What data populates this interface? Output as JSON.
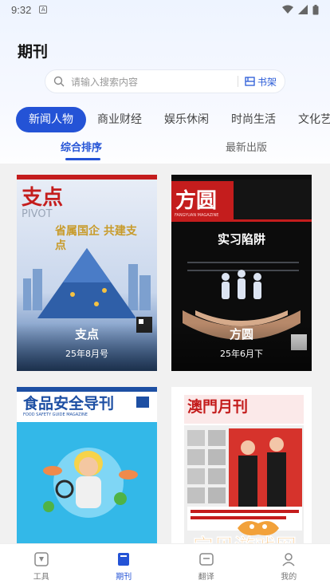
{
  "status": {
    "time": "9:32",
    "notif_badge": "A"
  },
  "page_title": "期刊",
  "search": {
    "placeholder": "请输入搜索内容",
    "shelf_label": "书架"
  },
  "categories": [
    "新闻人物",
    "商业财经",
    "娱乐休闲",
    "时尚生活",
    "文化艺"
  ],
  "active_category": "新闻人物",
  "sort_tabs": [
    "综合排序",
    "最新出版"
  ],
  "magazines": [
    {
      "title": "支点",
      "issue": "25年8月号",
      "cover_masthead": "支点",
      "cover_sub": "PIVOT",
      "cover_headline": "省属国企 共建支点"
    },
    {
      "title": "方圆",
      "issue": "25年6月下",
      "cover_masthead": "方圆",
      "cover_sub": "FANGYUAN MAGAZINE",
      "cover_headline": "实习陷阱"
    },
    {
      "title": "食品安全导刊",
      "issue": "",
      "cover_masthead": "食品安全导刊",
      "cover_sub": "FOOD SAFETY GUIDE MAGAZINE"
    },
    {
      "title": "澳門月刊",
      "issue": "",
      "cover_masthead": "澳門月刊"
    }
  ],
  "bottom_nav": [
    {
      "label": "工具",
      "icon": "tools-icon"
    },
    {
      "label": "期刊",
      "icon": "journal-icon"
    },
    {
      "label": "翻译",
      "icon": "translate-icon"
    },
    {
      "label": "我的",
      "icon": "profile-icon"
    }
  ],
  "watermark": {
    "text": "宝贝游戏网",
    "url": "baobeiy.com"
  },
  "colors": {
    "accent": "#2453d6",
    "bg_top": "#eef4ff",
    "content_bg": "#f1f1f1"
  }
}
